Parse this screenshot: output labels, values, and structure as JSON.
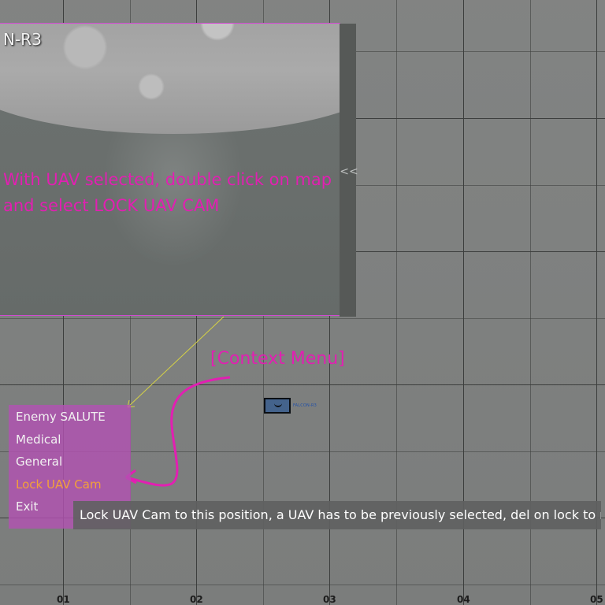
{
  "uav_feed": {
    "callsign": "N-R3",
    "instruction": "With UAV selected, double click on map\nand select LOCK UAV CAM",
    "collapse_symbol": "<<"
  },
  "annotation": {
    "context_menu_label": "[Context Menu]"
  },
  "unit": {
    "label": "FALCON-R3",
    "marker_color": "#44638c"
  },
  "context_menu": {
    "items": [
      {
        "label": "Enemy SALUTE"
      },
      {
        "label": "Medical"
      },
      {
        "label": "General"
      },
      {
        "label": "Lock UAV Cam",
        "highlighted": true
      },
      {
        "label": "Exit"
      }
    ],
    "background_color": "#b252b2",
    "highlight_color": "#f2a03a"
  },
  "tooltip": {
    "text": "Lock UAV Cam to this position, a UAV has to be previously selected, del on lock to release"
  },
  "map": {
    "grid_labels": [
      "01",
      "02",
      "03",
      "04",
      "05"
    ]
  },
  "colors": {
    "annotation_magenta": "#e21fb2",
    "map_background": "#7f8180"
  }
}
